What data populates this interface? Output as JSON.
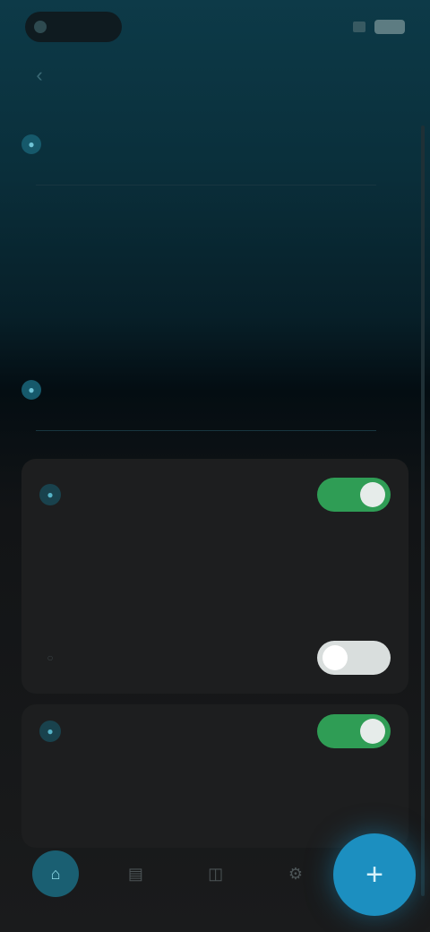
{
  "status_bar": {
    "time": "",
    "battery": ""
  },
  "nav": {
    "back_glyph": "‹"
  },
  "section_one": {
    "icon_glyph": "●",
    "title": "",
    "subtitle": "",
    "stats": [
      {
        "value": "",
        "label": ""
      },
      {
        "value": "",
        "label": ""
      },
      {
        "value": "",
        "label": ""
      }
    ]
  },
  "section_two": {
    "icon_glyph": "●",
    "title": "",
    "subtitle": ""
  },
  "card_one": {
    "row_top": {
      "label": "",
      "toggle_on": true
    },
    "stats": [
      {
        "value": "",
        "label": ""
      },
      {
        "value": "",
        "label": ""
      },
      {
        "value": "",
        "label": ""
      }
    ],
    "row_bottom": {
      "label": "",
      "toggle_on": false
    }
  },
  "card_two": {
    "row_top": {
      "label": "",
      "toggle_on": true
    },
    "stats": [
      {
        "value": "",
        "label": ""
      },
      {
        "value": "",
        "label": ""
      },
      {
        "value": "",
        "label": ""
      }
    ]
  },
  "bottom_nav": {
    "items": [
      {
        "name": "nav-home",
        "glyph": "⌂",
        "active": true
      },
      {
        "name": "nav-stats",
        "glyph": "▤",
        "active": false
      },
      {
        "name": "nav-devices",
        "glyph": "◫",
        "active": false
      },
      {
        "name": "nav-settings",
        "glyph": "⚙",
        "active": false
      }
    ],
    "fab_glyph": "+"
  },
  "colors": {
    "accent": "#1c8fc0",
    "toggle_on": "#2f9d55",
    "header_bg": "#0a2f3b",
    "card_bg": "#1d1e1f"
  }
}
